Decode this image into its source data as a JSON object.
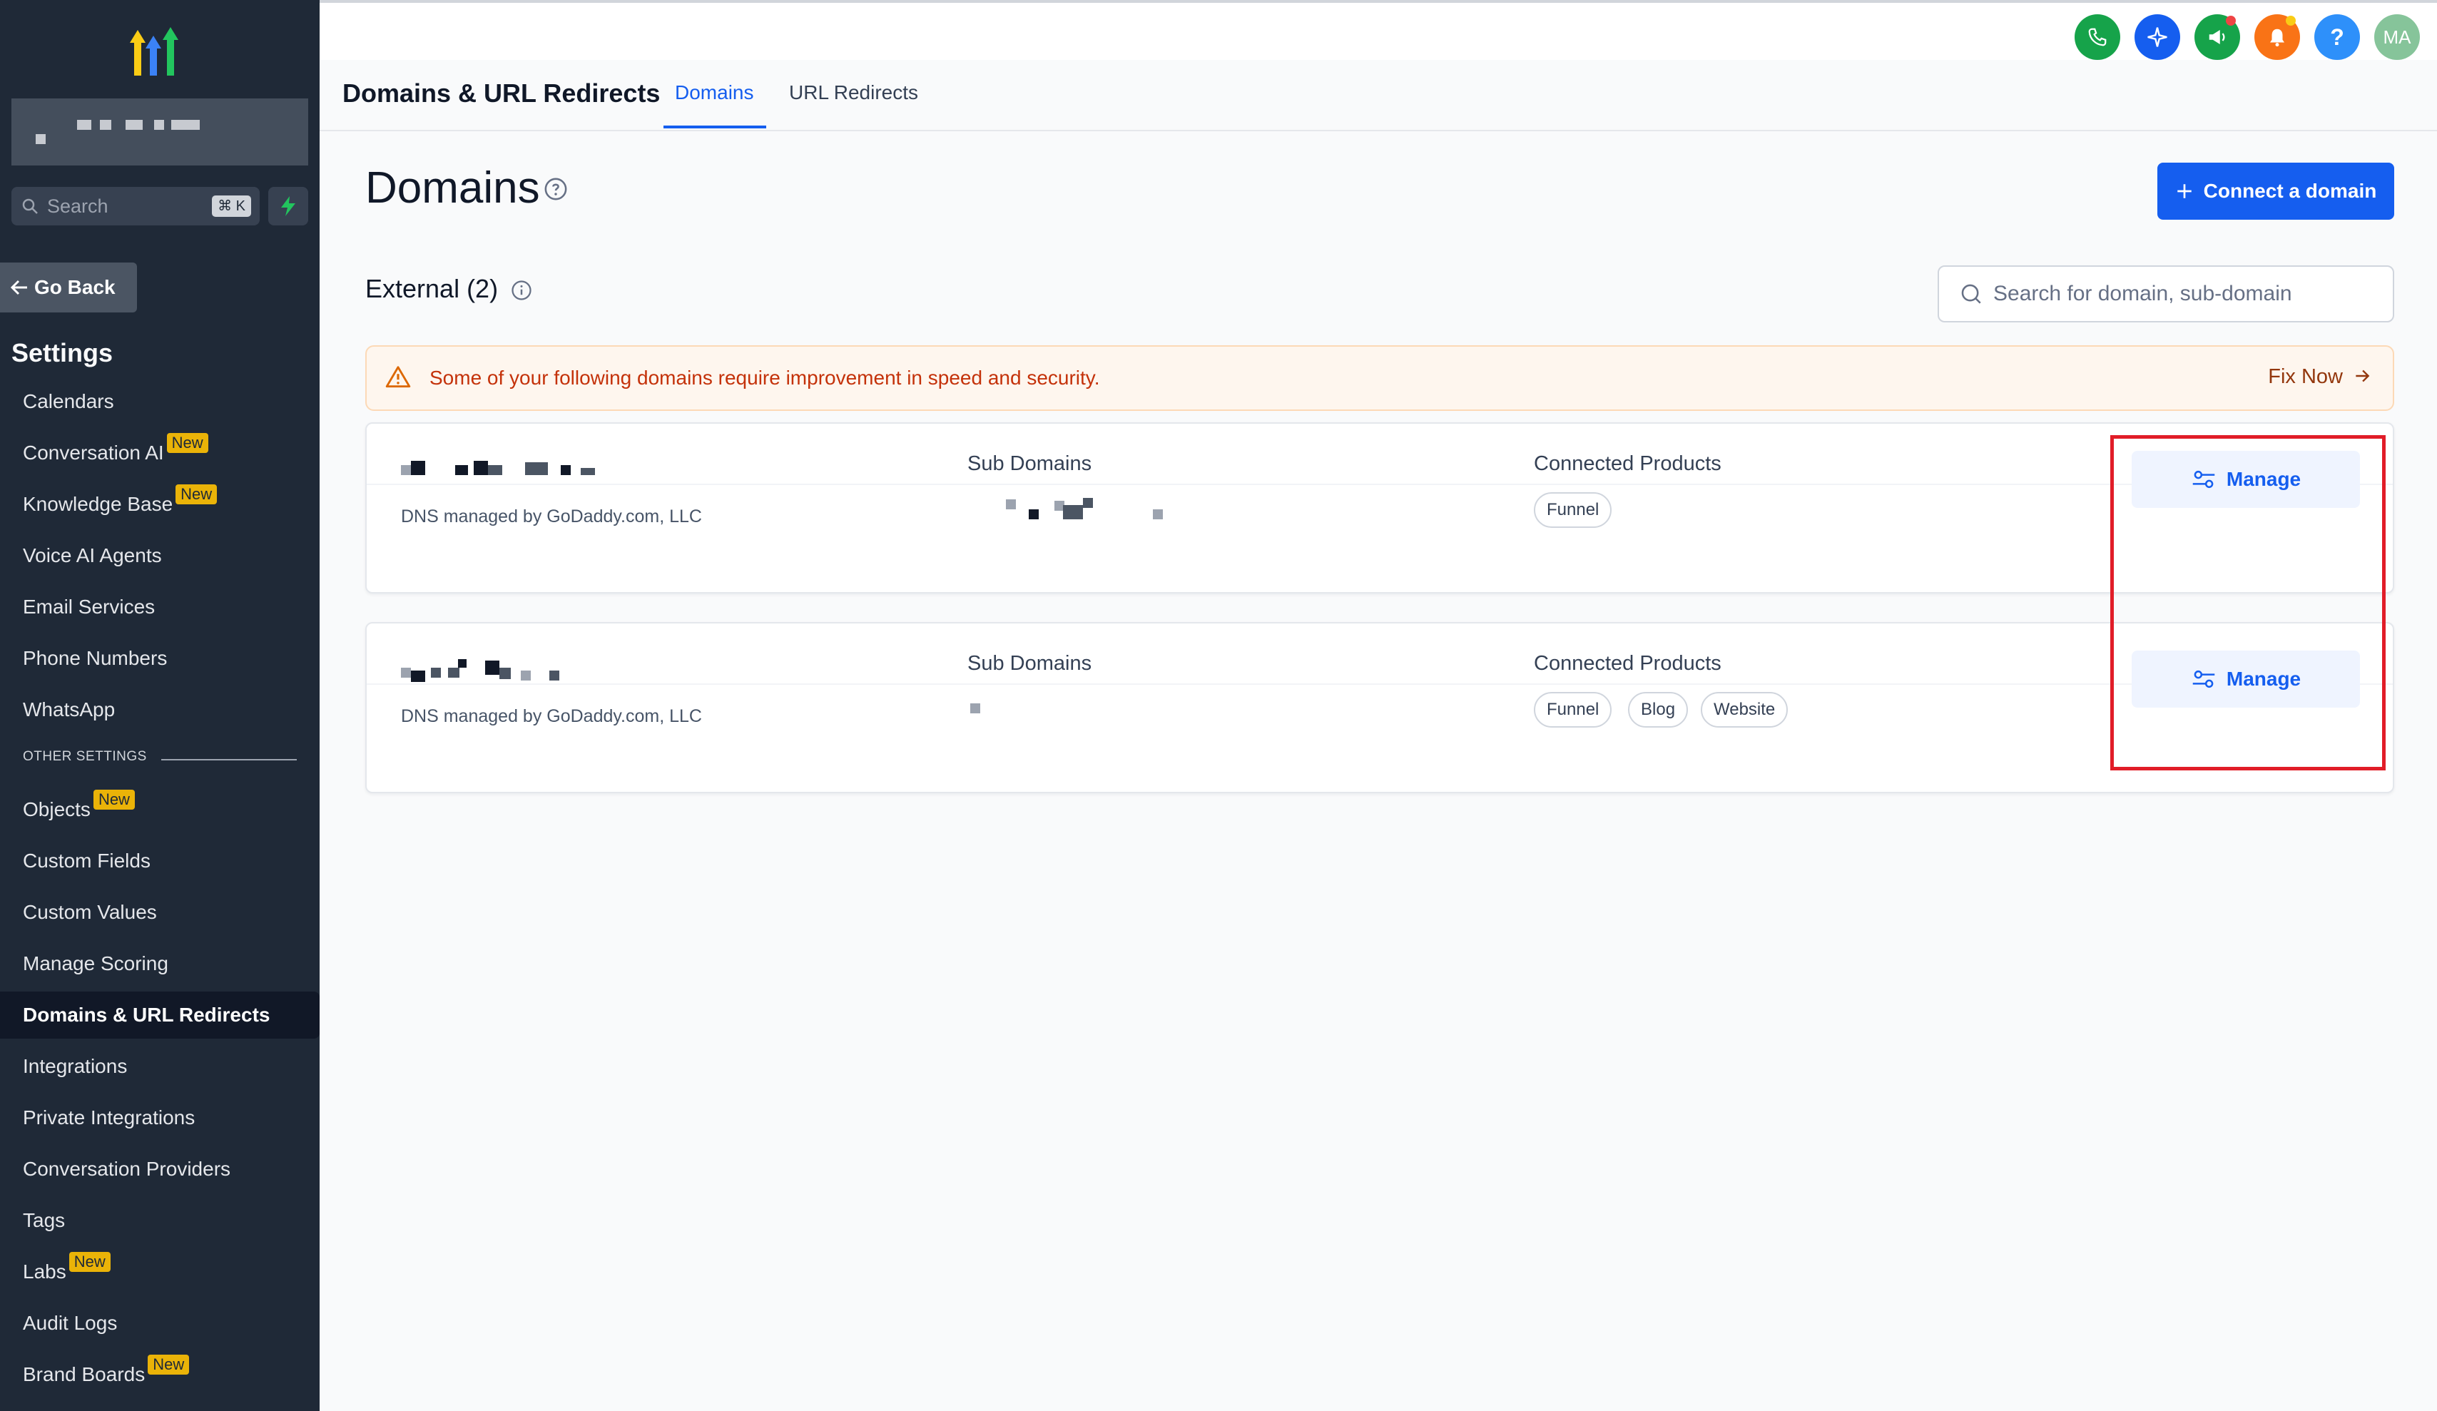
{
  "sidebar": {
    "search_placeholder": "Search",
    "search_shortcut": "⌘ K",
    "go_back": "Go Back",
    "settings_title": "Settings",
    "badge_new": "New",
    "items": [
      {
        "label": "Calendars",
        "badge": ""
      },
      {
        "label": "Conversation AI",
        "badge": "New"
      },
      {
        "label": "Knowledge Base",
        "badge": "New"
      },
      {
        "label": "Voice AI Agents",
        "badge": ""
      },
      {
        "label": "Email Services",
        "badge": ""
      },
      {
        "label": "Phone Numbers",
        "badge": ""
      },
      {
        "label": "WhatsApp",
        "badge": ""
      }
    ],
    "other_settings_label": "OTHER SETTINGS",
    "other_items": [
      {
        "label": "Objects",
        "badge": "New"
      },
      {
        "label": "Custom Fields",
        "badge": ""
      },
      {
        "label": "Custom Values",
        "badge": ""
      },
      {
        "label": "Manage Scoring",
        "badge": ""
      },
      {
        "label": "Domains & URL Redirects",
        "badge": "",
        "active": true
      },
      {
        "label": "Integrations",
        "badge": ""
      },
      {
        "label": "Private Integrations",
        "badge": ""
      },
      {
        "label": "Conversation Providers",
        "badge": ""
      },
      {
        "label": "Tags",
        "badge": ""
      },
      {
        "label": "Labs",
        "badge": "New"
      },
      {
        "label": "Audit Logs",
        "badge": ""
      },
      {
        "label": "Brand Boards",
        "badge": "New"
      }
    ]
  },
  "topbar": {
    "icons": [
      "phone-icon",
      "sparkle-icon",
      "megaphone-icon",
      "bell-icon",
      "help-icon"
    ],
    "avatar_initials": "MA",
    "colors": {
      "phone": "#16a34a",
      "sparkle": "#155eef",
      "megaphone": "#16a34a",
      "bell": "#f97316",
      "help": "#2e90fa",
      "avatar": "#86c49a"
    }
  },
  "subheader": {
    "title": "Domains & URL Redirects",
    "tabs": [
      {
        "label": "Domains",
        "active": true
      },
      {
        "label": "URL Redirects",
        "active": false
      }
    ]
  },
  "main": {
    "title": "Domains",
    "connect_button": "Connect a domain",
    "external_title": "External (2)",
    "search_placeholder": "Search for domain, sub-domain",
    "warning": {
      "text": "Some of your following domains require improvement in speed and security.",
      "action": "Fix Now"
    },
    "columns": {
      "sub_domains": "Sub Domains",
      "connected_products": "Connected Products"
    },
    "domains": [
      {
        "dns": "DNS managed by GoDaddy.com, LLC",
        "products": [
          "Funnel"
        ],
        "manage": "Manage"
      },
      {
        "dns": "DNS managed by GoDaddy.com, LLC",
        "products": [
          "Funnel",
          "Blog",
          "Website"
        ],
        "manage": "Manage"
      }
    ]
  }
}
